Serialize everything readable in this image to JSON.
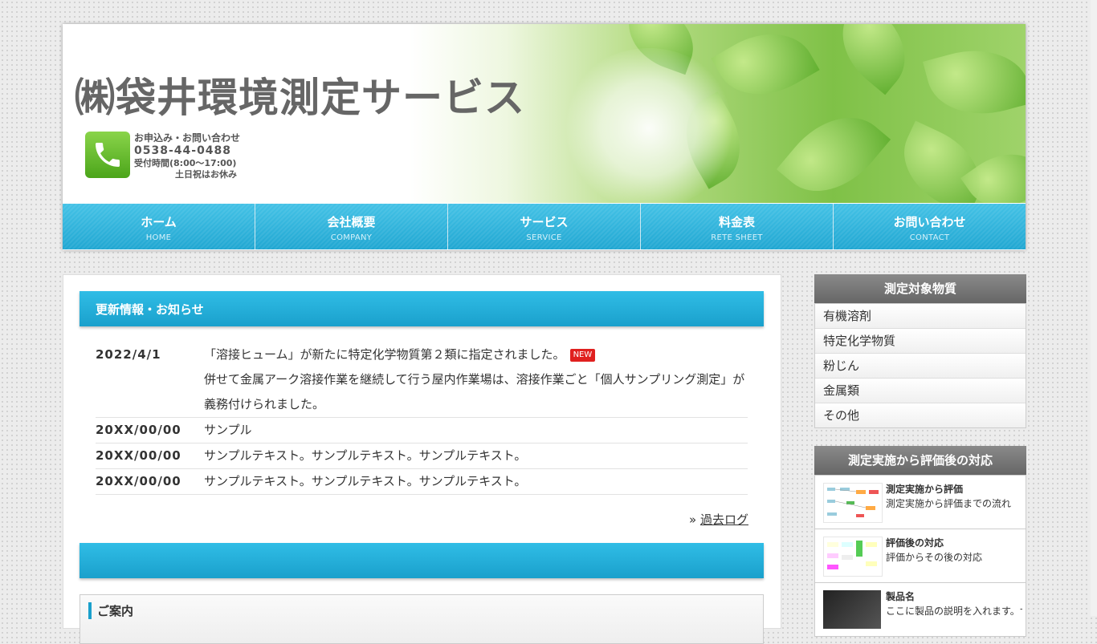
{
  "header": {
    "company_name": "㈱袋井環境測定サービス",
    "contact_line1": "お申込み・お問い合わせ",
    "phone": "0538-44-0488",
    "hours": "受付時間(8:00～17:00)",
    "closed": "土日祝はお休み"
  },
  "nav": [
    {
      "jp": "ホーム",
      "en": "HOME"
    },
    {
      "jp": "会社概要",
      "en": "COMPANY"
    },
    {
      "jp": "サービス",
      "en": "SERVICE"
    },
    {
      "jp": "料金表",
      "en": "RETE SHEET"
    },
    {
      "jp": "お問い合わせ",
      "en": "CONTACT"
    }
  ],
  "news": {
    "title": "更新情報・お知らせ",
    "items": [
      {
        "date": "2022/4/1",
        "text": "「溶接ヒューム」が新たに特定化学物質第２類に指定されました。",
        "badge": "NEW",
        "text2": "併せて金属アーク溶接作業を継続して行う屋内作業場は、溶接作業ごと「個人サンプリング測定」が",
        "text3": "義務付けられました。"
      },
      {
        "date": "20XX/00/00",
        "text": "サンプル"
      },
      {
        "date": "20XX/00/00",
        "text": "サンプルテキスト。サンプルテキスト。サンプルテキスト。"
      },
      {
        "date": "20XX/00/00",
        "text": "サンプルテキスト。サンプルテキスト。サンプルテキスト。"
      }
    ],
    "past_log_prefix": "»",
    "past_log": "過去ログ"
  },
  "guide": {
    "title": "ご案内"
  },
  "sidebar": {
    "substances_title": "測定対象物質",
    "substances": [
      "有機溶剤",
      "特定化学物質",
      "粉じん",
      "金属類",
      "その他"
    ],
    "response_title": "測定実施から評価後の対応",
    "cards": [
      {
        "title": "測定実施から評価",
        "desc": "測定実施から評価までの流れ"
      },
      {
        "title": "評価後の対応",
        "desc": "評価からその後の対応"
      },
      {
        "title": "製品名",
        "desc": "ここに製品の説明を入れます。サ"
      }
    ]
  },
  "colors": {
    "nav_blue": "#21a7d2",
    "section_blue": "#1aa0cc",
    "sidebar_header": "#777777",
    "new_badge": "#e0201f"
  }
}
